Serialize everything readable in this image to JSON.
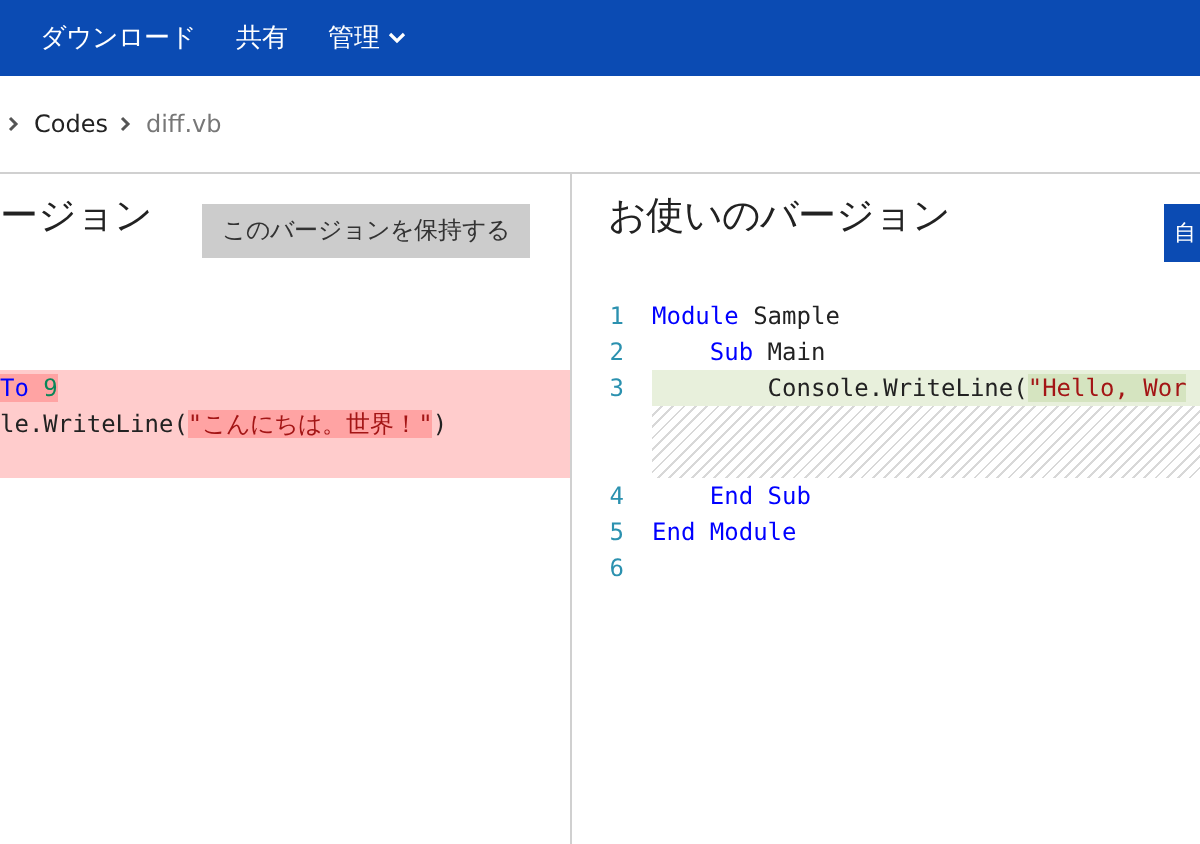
{
  "top_bar": {
    "items": [
      {
        "label": "ダウンロード",
        "dropdown": false
      },
      {
        "label": "共有",
        "dropdown": false
      },
      {
        "label": "管理",
        "dropdown": true
      }
    ]
  },
  "breadcrumb": [
    {
      "label": "Codes",
      "current": false
    },
    {
      "label": "diff.vb",
      "current": true
    }
  ],
  "left_pane": {
    "title": "ージョン",
    "button": "このバージョンを保持する",
    "lines": [
      {
        "kind": "context"
      },
      {
        "kind": "context"
      },
      {
        "kind": "removed",
        "segments": [
          {
            "text": "To",
            "kind": "keyword",
            "changed": true
          },
          {
            "text": " 9",
            "kind": "number",
            "changed": true
          }
        ]
      },
      {
        "kind": "removed",
        "segments": [
          {
            "text": "le.WriteLine(",
            "kind": "plain",
            "changed": false
          },
          {
            "text": "\"こんにちは。世界！\"",
            "kind": "string",
            "changed": true
          },
          {
            "text": ")",
            "kind": "plain",
            "changed": false
          }
        ]
      },
      {
        "kind": "removed"
      }
    ]
  },
  "right_pane": {
    "title": "お使いのバージョン",
    "button": "自",
    "lines": [
      {
        "kind": "context",
        "number": "1",
        "segments": [
          {
            "text": "Module",
            "kind": "keyword",
            "changed": false
          },
          {
            "text": " Sample",
            "kind": "plain",
            "changed": false
          }
        ]
      },
      {
        "kind": "context",
        "number": "2",
        "segments": [
          {
            "text": "    Sub",
            "kind": "keyword",
            "changed": false
          },
          {
            "text": " Main",
            "kind": "plain",
            "changed": false
          }
        ]
      },
      {
        "kind": "added",
        "number": "3",
        "segments": [
          {
            "text": "        Console.WriteLine(",
            "kind": "plain",
            "changed": false
          },
          {
            "text": "\"Hello, Wor",
            "kind": "string",
            "changed": true
          }
        ]
      },
      {
        "kind": "gap"
      },
      {
        "kind": "context",
        "number": "4",
        "segments": [
          {
            "text": "    End Sub",
            "kind": "keyword",
            "changed": false
          }
        ]
      },
      {
        "kind": "context",
        "number": "5",
        "segments": [
          {
            "text": "End Module",
            "kind": "keyword",
            "changed": false
          }
        ]
      },
      {
        "kind": "context",
        "number": "6"
      }
    ]
  }
}
